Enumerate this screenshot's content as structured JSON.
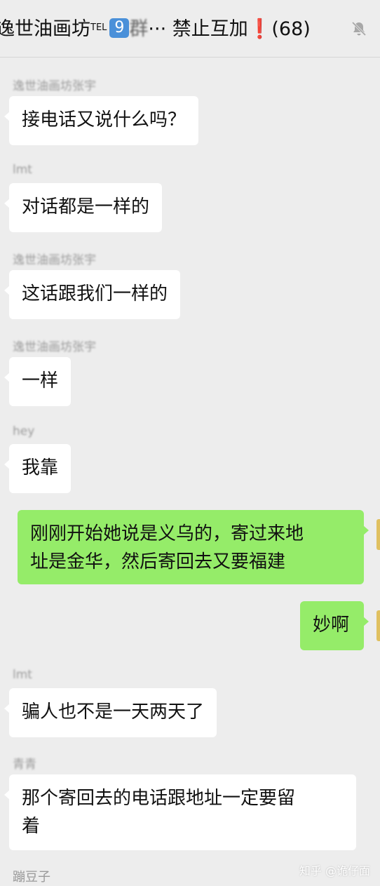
{
  "header": {
    "title_part1": "逸世油画坊",
    "tel": "TEL",
    "badge": "9",
    "blurred": "群",
    "title_part2": "··· 禁止互加",
    "excl": "❗",
    "count": "(68)",
    "mute_icon": "bell-off-icon"
  },
  "messages": [
    {
      "sender": "逸世油画坊张宇",
      "text": "接电话又说什么吗？",
      "side": "left"
    },
    {
      "sender": "lmt",
      "text": "对话都是一样的",
      "side": "left"
    },
    {
      "sender": "逸世油画坊张宇",
      "text": "这话跟我们一样的",
      "side": "left"
    },
    {
      "sender": "逸世油画坊张宇",
      "text": "一样",
      "side": "left"
    },
    {
      "sender": "hey",
      "text": "我靠",
      "side": "left"
    },
    {
      "sender": "",
      "line1": "刚刚开始她说是义乌的，寄过来地",
      "line2": "址是金华，然后寄回去又要福建",
      "side": "right"
    },
    {
      "sender": "",
      "text": "妙啊",
      "side": "right"
    },
    {
      "sender": "lmt",
      "text": "骗人也不是一天两天了",
      "side": "left"
    },
    {
      "sender": "青青",
      "line1": "那个寄回去的电话跟地址一定要留",
      "line2": "着",
      "side": "left"
    },
    {
      "sender": "蹦豆子",
      "text": "",
      "side": "left"
    }
  ],
  "watermark": "知乎 @诡仔面"
}
